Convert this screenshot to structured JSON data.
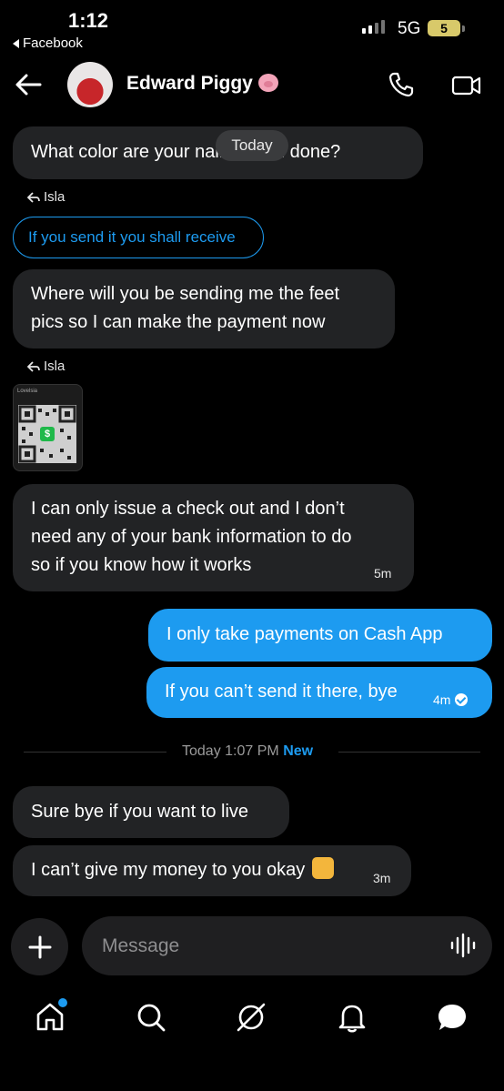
{
  "status_bar": {
    "time": "1:12",
    "back_app": "Facebook",
    "network": "5G",
    "battery": "5"
  },
  "header": {
    "contact_name": "Edward Piggy"
  },
  "thread": {
    "today_pill": "Today",
    "msg1": "What color are your nails polish done?",
    "reply1_to": "Isla",
    "quoted1": "If you send it you shall receive",
    "msg2_line1": "Where will you be sending me the feet",
    "msg2_line2": "pics so I can make the payment now",
    "reply2_to": "Isla",
    "qr_title": "Lovelsia",
    "qr_symbol": "$",
    "msg3_line1": "I can only issue a check out and I don’t",
    "msg3_line2": "need any of your bank information to do",
    "msg3_line3": "so if you know how it works",
    "msg3_time": "5m",
    "out1": "I only take payments on Cash App",
    "out2": "If you can’t send it there, bye",
    "out2_time": "4m",
    "divider_time": "Today 1:07 PM",
    "divider_new": "New",
    "msg4": "Sure bye if you want to live",
    "msg5": "I can’t give my money to you okay",
    "msg5_time": "3m"
  },
  "composer": {
    "placeholder": "Message"
  },
  "colors": {
    "accent": "#1d9bf0",
    "incoming_bubble": "#222325",
    "background": "#000000"
  },
  "icons": [
    "back-arrow-icon",
    "phone-icon",
    "video-icon",
    "plus-icon",
    "voice-icon",
    "home-icon",
    "search-icon",
    "grok-icon",
    "bell-icon",
    "chat-icon"
  ]
}
